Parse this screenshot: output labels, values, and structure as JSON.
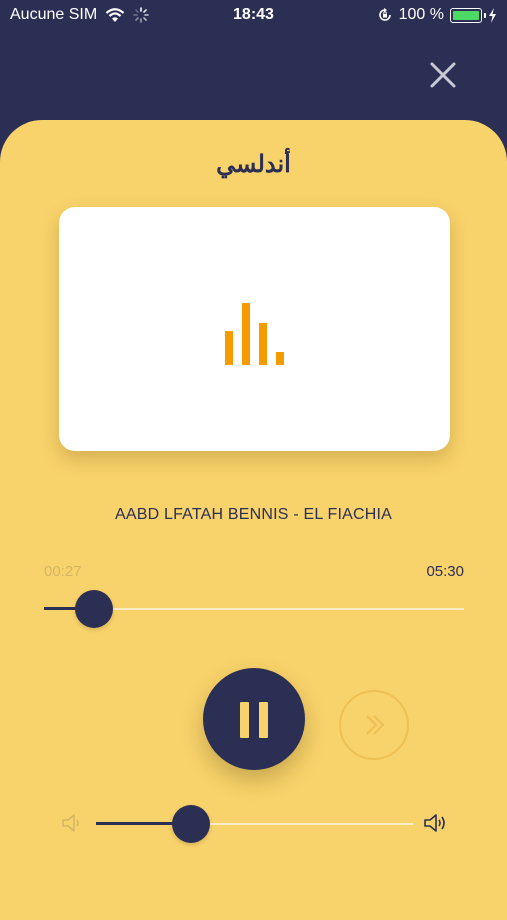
{
  "status_bar": {
    "carrier": "Aucune SIM",
    "time": "18:43",
    "battery_percent": "100 %"
  },
  "header": {
    "close_icon": "close-icon"
  },
  "player": {
    "title": "أندلسي",
    "artwork_icon": "equalizer-icon",
    "track": "AABD LFATAH BENNIS - EL FIACHIA",
    "elapsed": "00:27",
    "duration": "05:30",
    "progress_fraction": 0.12,
    "volume_fraction": 0.3,
    "controls": {
      "pause_icon": "pause-icon",
      "next_icon": "fast-forward-icon",
      "volume_low_icon": "volume-low-icon",
      "volume_high_icon": "volume-high-icon"
    }
  },
  "colors": {
    "navy": "#2c2f54",
    "yellow": "#f8d26a",
    "orange": "#f59b00"
  }
}
